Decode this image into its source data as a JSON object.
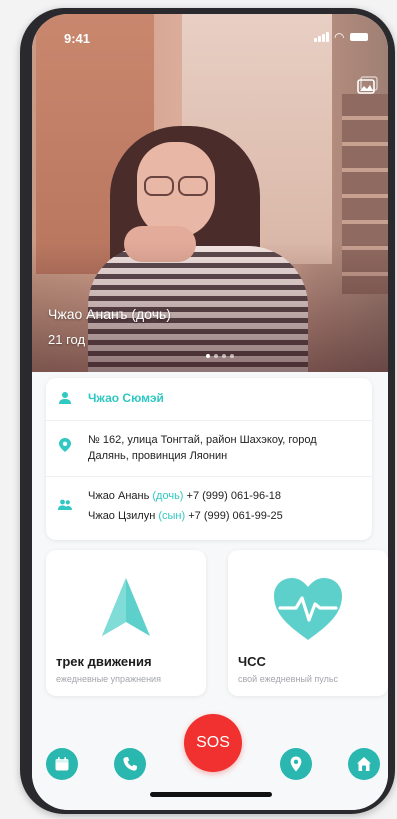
{
  "status_bar": {
    "time": "9:41"
  },
  "hero": {
    "name": "Чжао Ананъ (дочь)",
    "age": "21 год"
  },
  "contact": {
    "name": "Чжао Сюмэй"
  },
  "address": {
    "text": "№ 162, улица Тонгтай, район Шахэкоу, город Далянь, провинция Ляонин"
  },
  "family": [
    {
      "name": "Чжао Анань ",
      "relation": "(дочь)",
      "phone": " +7  (999)  061-96-18"
    },
    {
      "name": "Чжао Цзилун ",
      "relation": "(сын)",
      "phone": " +7  (999)  061-99-25"
    }
  ],
  "tiles": {
    "track": {
      "title": "трек движения",
      "subtitle": "ежедневные упражнения"
    },
    "heart": {
      "title": "ЧСС",
      "subtitle": "свой ежедневный пульс"
    }
  },
  "bottom_nav": {
    "sos_label": "SOS",
    "items": [
      "calendar-icon",
      "phone-icon",
      "sos-button",
      "location-icon",
      "home-icon"
    ]
  },
  "colors": {
    "accent": "#2ab7b0",
    "accent_text": "#30c8c2",
    "sos": "#f0312f"
  }
}
